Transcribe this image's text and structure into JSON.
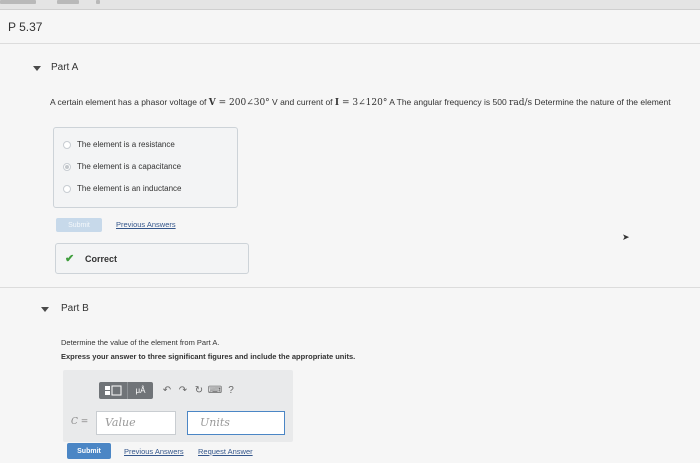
{
  "problem": {
    "title": "P 5.37"
  },
  "partA": {
    "label": "Part A",
    "question": {
      "p1": "A certain element has a phasor voltage of ",
      "V": "V",
      "eq1": " = 200∠30°",
      "p2": " V and current of ",
      "I": "I",
      "eq2": " = 3∠120°",
      "p3": " A  The angular frequency is 500 ",
      "unit": "rad/s",
      "p4": "  Determine the nature of the element"
    },
    "options": [
      {
        "label": "The element is a resistance",
        "selected": false
      },
      {
        "label": "The element is a capacitance",
        "selected": true
      },
      {
        "label": "The element is an inductance",
        "selected": false
      }
    ],
    "submit_label": "Submit",
    "previous_answers": "Previous Answers",
    "feedback": "Correct"
  },
  "partB": {
    "label": "Part B",
    "question": "Determine the value of the element from Part A.",
    "instruction": "Express your answer to three significant figures and include the appropriate units.",
    "variable": "C =",
    "toolbar": {
      "template_icon": "template-icon",
      "units_button": "μÅ",
      "help": "?"
    },
    "value_placeholder": "Value",
    "units_placeholder": "Units",
    "submit_label": "Submit",
    "previous_answers": "Previous Answers",
    "request_answer": "Request Answer"
  },
  "colors": {
    "accent": "#4b86c5",
    "correct": "#3f9e3d"
  }
}
